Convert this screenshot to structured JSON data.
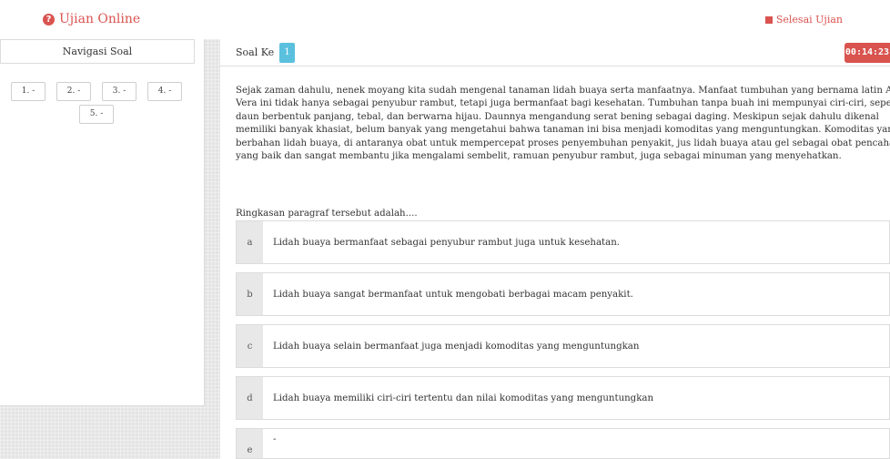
{
  "header": {
    "brand": "Ujian Online",
    "finish_label": "Selesai Ujian",
    "accent_color": "#d9534f"
  },
  "nav": {
    "title": "Navigasi Soal",
    "buttons": [
      "1. -",
      "2. -",
      "3. -",
      "4. -",
      "5. -"
    ]
  },
  "question": {
    "label": "Soal Ke",
    "number": "1",
    "timer": "00:14:23",
    "passage_lines": [
      "Sejak zaman dahulu, nenek moyang kita sudah mengenal tanaman lidah buaya serta manfaatnya. Manfaat tumbuhan yang bernama latin Aloe",
      "Vera ini tidak hanya sebagai penyubur rambut, tetapi juga bermanfaat bagi kesehatan. Tumbuhan tanpa buah ini mempunyai ciri-ciri, seperti",
      "daun berbentuk panjang, tebal, dan berwarna hijau. Daunnya mengandung serat bening sebagai daging. Meskipun sejak dahulu dikenal",
      "memiliki banyak khasiat, belum banyak yang mengetahui bahwa tanaman ini bisa menjadi komoditas yang menguntungkan. Komoditas yang",
      "berbahan lidah buaya, di antaranya obat untuk mempercepat proses penyembuhan penyakit, jus lidah buaya atau gel sebagai obat pencahar",
      "yang baik dan sangat membantu jika mengalami sembelit, ramuan penyubur rambut, juga sebagai minuman yang menyehatkan."
    ],
    "prompt": "Ringkasan paragraf tersebut adalah....",
    "options": [
      {
        "letter": "a",
        "text": "Lidah buaya bermanfaat sebagai penyubur rambut juga untuk kesehatan."
      },
      {
        "letter": "b",
        "text": "Lidah buaya sangat bermanfaat untuk mengobati berbagai macam penyakit."
      },
      {
        "letter": "c",
        "text": "Lidah buaya selain bermanfaat juga menjadi komoditas yang menguntungkan"
      },
      {
        "letter": "d",
        "text": "Lidah buaya memiliki ciri-ciri tertentu dan nilai komoditas yang menguntungkan"
      },
      {
        "letter": "e",
        "text": "-"
      }
    ]
  }
}
